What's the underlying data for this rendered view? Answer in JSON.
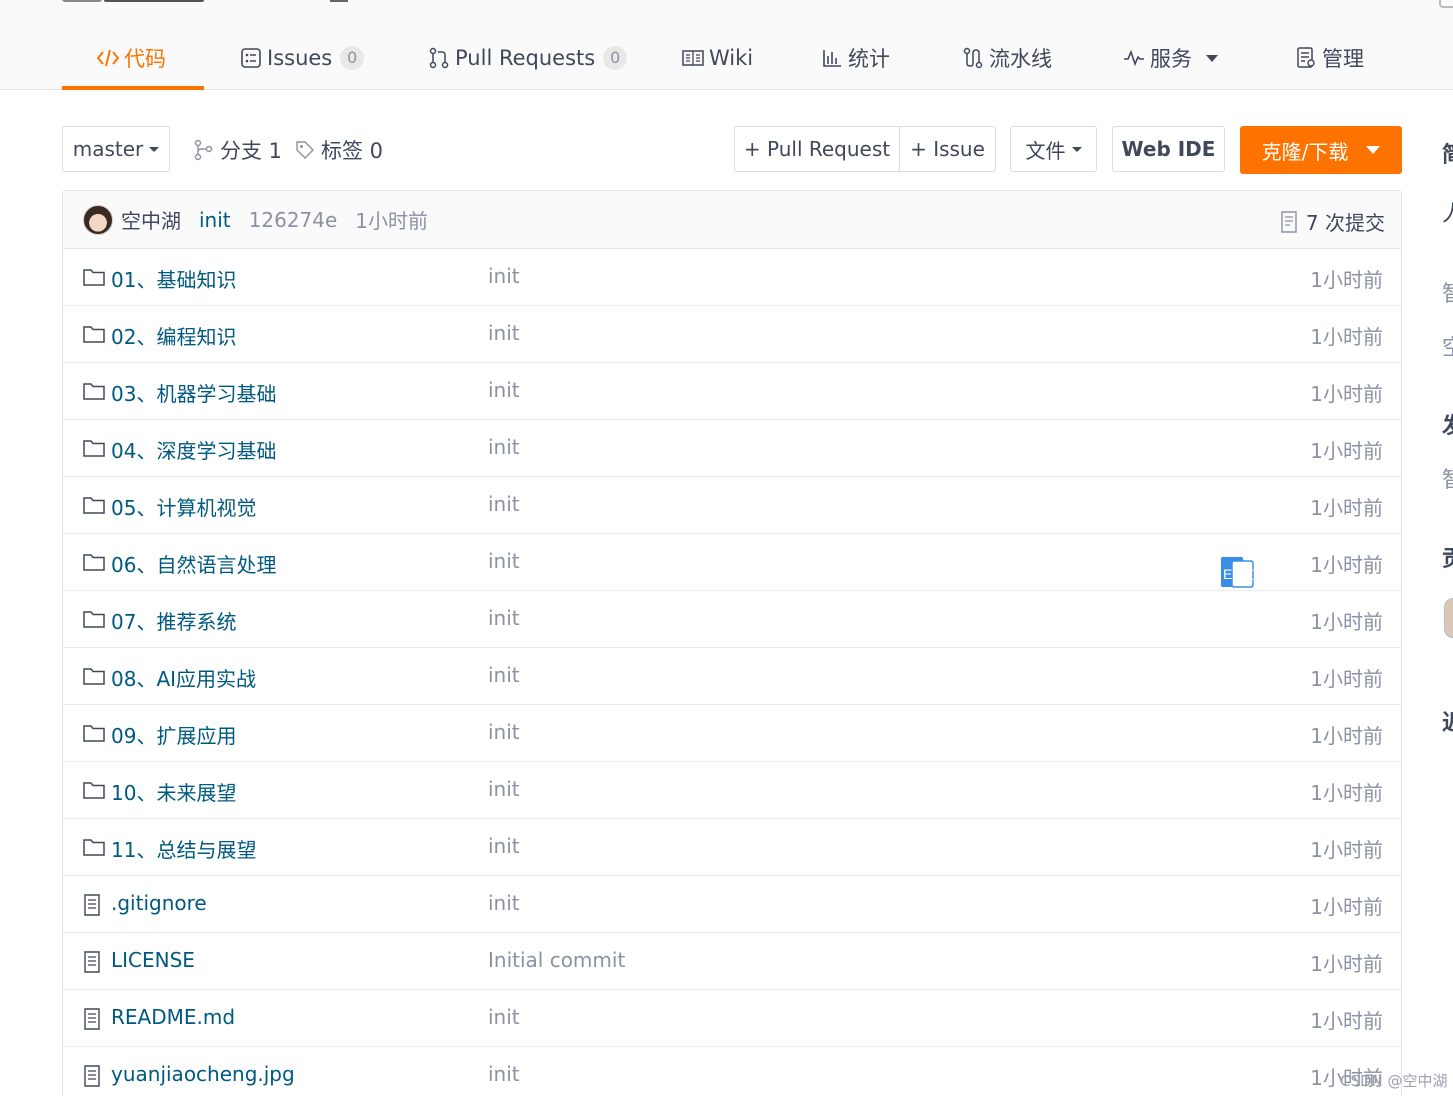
{
  "tabs": [
    {
      "label": "代码",
      "icon": "code-icon",
      "active": true
    },
    {
      "label": "Issues",
      "icon": "issues-icon",
      "count": "0"
    },
    {
      "label": "Pull Requests",
      "icon": "pull-request-icon",
      "count": "0"
    },
    {
      "label": "Wiki",
      "icon": "wiki-icon"
    },
    {
      "label": "统计",
      "icon": "stats-icon"
    },
    {
      "label": "流水线",
      "icon": "pipeline-icon"
    },
    {
      "label": "服务",
      "icon": "service-icon",
      "dropdown": true
    },
    {
      "label": "管理",
      "icon": "manage-icon"
    }
  ],
  "toolbar": {
    "branch": "master",
    "branches_label": "分支 1",
    "tags_label": "标签 0",
    "pull_request_btn": "+ Pull Request",
    "issue_btn": "+ Issue",
    "file_btn": "文件",
    "web_ide_btn": "Web IDE",
    "clone_btn": "克隆/下载"
  },
  "commit": {
    "author": "空中湖",
    "message": "init",
    "sha": "126274e",
    "time": "1小时前",
    "count_label": "7 次提交"
  },
  "files": [
    {
      "name": "01、基础知识",
      "type": "folder",
      "message": "init",
      "time": "1小时前"
    },
    {
      "name": "02、编程知识",
      "type": "folder",
      "message": "init",
      "time": "1小时前"
    },
    {
      "name": "03、机器学习基础",
      "type": "folder",
      "message": "init",
      "time": "1小时前"
    },
    {
      "name": "04、深度学习基础",
      "type": "folder",
      "message": "init",
      "time": "1小时前"
    },
    {
      "name": "05、计算机视觉",
      "type": "folder",
      "message": "init",
      "time": "1小时前"
    },
    {
      "name": "06、自然语言处理",
      "type": "folder",
      "message": "init",
      "time": "1小时前"
    },
    {
      "name": "07、推荐系统",
      "type": "folder",
      "message": "init",
      "time": "1小时前"
    },
    {
      "name": "08、AI应用实战",
      "type": "folder",
      "message": "init",
      "time": "1小时前"
    },
    {
      "name": "09、扩展应用",
      "type": "folder",
      "message": "init",
      "time": "1小时前"
    },
    {
      "name": "10、未来展望",
      "type": "folder",
      "message": "init",
      "time": "1小时前"
    },
    {
      "name": "11、总结与展望",
      "type": "folder",
      "message": "init",
      "time": "1小时前"
    },
    {
      "name": ".gitignore",
      "type": "file",
      "message": "init",
      "time": "1小时前"
    },
    {
      "name": "LICENSE",
      "type": "file",
      "message": "Initial commit",
      "time": "1小时前"
    },
    {
      "name": "README.md",
      "type": "file",
      "message": "init",
      "time": "1小时前"
    },
    {
      "name": "yuanjiaocheng.jpg",
      "type": "file",
      "message": "init",
      "time": "1小时前"
    }
  ],
  "sidebar_fragments": [
    "简",
    "人",
    "智",
    "空",
    "发",
    "智",
    "贡",
    "近"
  ],
  "translate_badge": "En文",
  "watermark": "CSDN @空中湖",
  "colors": {
    "accent": "#fe7300",
    "link": "#005980",
    "muted": "#8c92a4",
    "text": "#40485b"
  }
}
